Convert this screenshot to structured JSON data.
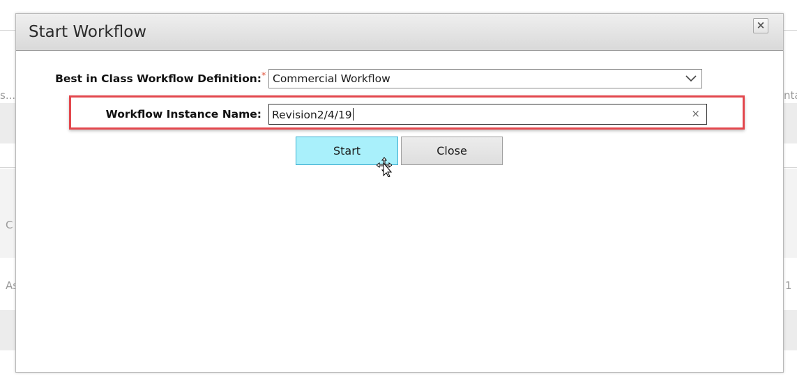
{
  "background": {
    "left_fragments": [
      "s...",
      "C",
      "As"
    ],
    "right_fragments": [
      "nta",
      "1"
    ]
  },
  "dialog": {
    "title": "Start Workflow",
    "close_label": "×"
  },
  "form": {
    "definition": {
      "label": "Best in Class Workflow Definition:",
      "required_marker": "*",
      "value": "Commercial Workflow"
    },
    "instance_name": {
      "label": "Workflow Instance Name:",
      "value": "Revision2/4/19",
      "clear_label": "×"
    }
  },
  "buttons": {
    "start_label": "Start",
    "close_label": "Close"
  },
  "colors": {
    "start_button_bg": "#a9f0fb",
    "highlight_border": "#e3474d",
    "required_marker": "#e0523b"
  },
  "icons": {
    "dropdown": "chevron-down-icon",
    "clear": "clear-icon",
    "cursor": "move-cursor-icon"
  }
}
